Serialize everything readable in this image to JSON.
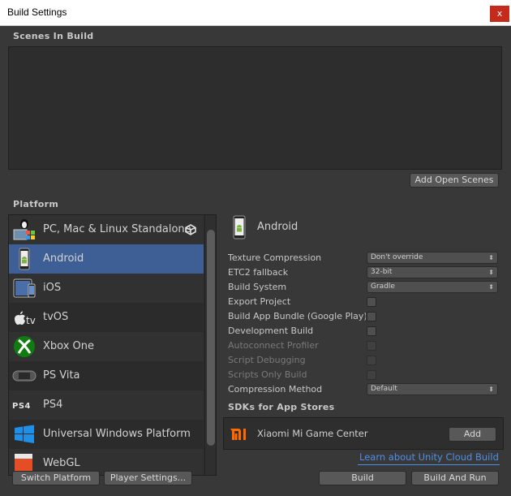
{
  "window": {
    "title": "Build Settings",
    "close_glyph": "x"
  },
  "scenes": {
    "label": "Scenes In Build",
    "add_open_scenes": "Add Open Scenes"
  },
  "platform": {
    "label": "Platform",
    "items": [
      {
        "label": "PC, Mac & Linux Standalone",
        "icon": "pc-mac-linux-icon"
      },
      {
        "label": "Android",
        "icon": "android-icon",
        "selected": true
      },
      {
        "label": "iOS",
        "icon": "ios-icon"
      },
      {
        "label": "tvOS",
        "icon": "tvos-icon"
      },
      {
        "label": "Xbox One",
        "icon": "xbox-icon"
      },
      {
        "label": "PS Vita",
        "icon": "ps-vita-icon"
      },
      {
        "label": "PS4",
        "icon": "ps4-icon"
      },
      {
        "label": "Universal Windows Platform",
        "icon": "windows-icon"
      },
      {
        "label": "WebGL",
        "icon": "webgl-icon"
      }
    ]
  },
  "selected_platform": {
    "name": "Android"
  },
  "settings": {
    "texture_compression": {
      "label": "Texture Compression",
      "value": "Don't override"
    },
    "etc2_fallback": {
      "label": "ETC2 fallback",
      "value": "32-bit"
    },
    "build_system": {
      "label": "Build System",
      "value": "Gradle"
    },
    "export_project": {
      "label": "Export Project"
    },
    "build_app_bundle": {
      "label": "Build App Bundle (Google Play)"
    },
    "development_build": {
      "label": "Development Build"
    },
    "autoconnect_profiler": {
      "label": "Autoconnect Profiler"
    },
    "script_debugging": {
      "label": "Script Debugging"
    },
    "scripts_only_build": {
      "label": "Scripts Only Build"
    },
    "compression_method": {
      "label": "Compression Method",
      "value": "Default"
    }
  },
  "sdk": {
    "label": "SDKs for App Stores",
    "item": {
      "name": "Xiaomi Mi Game Center",
      "add": "Add"
    },
    "cloud_link": "Learn about Unity Cloud Build"
  },
  "buttons": {
    "switch_platform": "Switch Platform",
    "player_settings": "Player Settings...",
    "build": "Build",
    "build_and_run": "Build And Run"
  },
  "colors": {
    "selection": "#3e5f96",
    "link": "#4f8fea",
    "close": "#c42b1c"
  }
}
